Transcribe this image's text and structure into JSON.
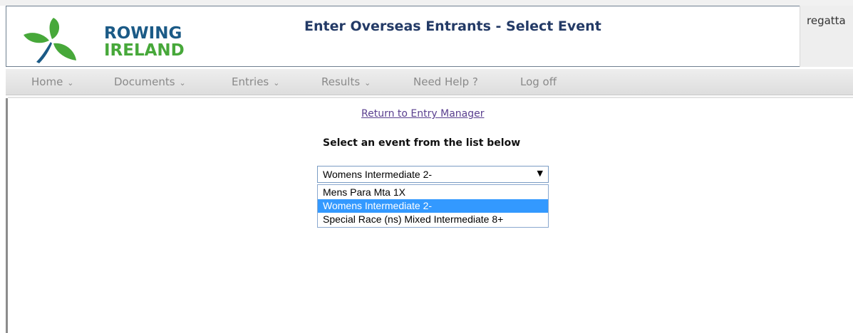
{
  "header": {
    "logo_line1": "ROWING",
    "logo_line2": "IRELAND",
    "title": "Enter Overseas Entrants - Select Event",
    "user_label": "regatta"
  },
  "nav": {
    "items": [
      {
        "label": "Home",
        "dropdown": true
      },
      {
        "label": "Documents",
        "dropdown": true
      },
      {
        "label": "Entries",
        "dropdown": true
      },
      {
        "label": "Results",
        "dropdown": true
      },
      {
        "label": "Need Help ?",
        "dropdown": false
      },
      {
        "label": "Log off",
        "dropdown": false
      }
    ],
    "caret": "⌄"
  },
  "main": {
    "return_link": "Return to Entry Manager",
    "heading": "Select an event from the list below",
    "event_select": {
      "value": "Womens Intermediate 2-",
      "arrow": "▼",
      "options": [
        {
          "label": "Mens Para Mta 1X",
          "selected": false
        },
        {
          "label": "Womens Intermediate 2-",
          "selected": true
        },
        {
          "label": "Special Race (ns) Mixed Intermediate 8+",
          "selected": false
        }
      ]
    }
  },
  "colors": {
    "logo_blue": "#1b5a86",
    "logo_green": "#47a83a",
    "title_navy": "#233a66",
    "link_purple": "#5a3f8f",
    "selection_blue": "#3399ff"
  }
}
